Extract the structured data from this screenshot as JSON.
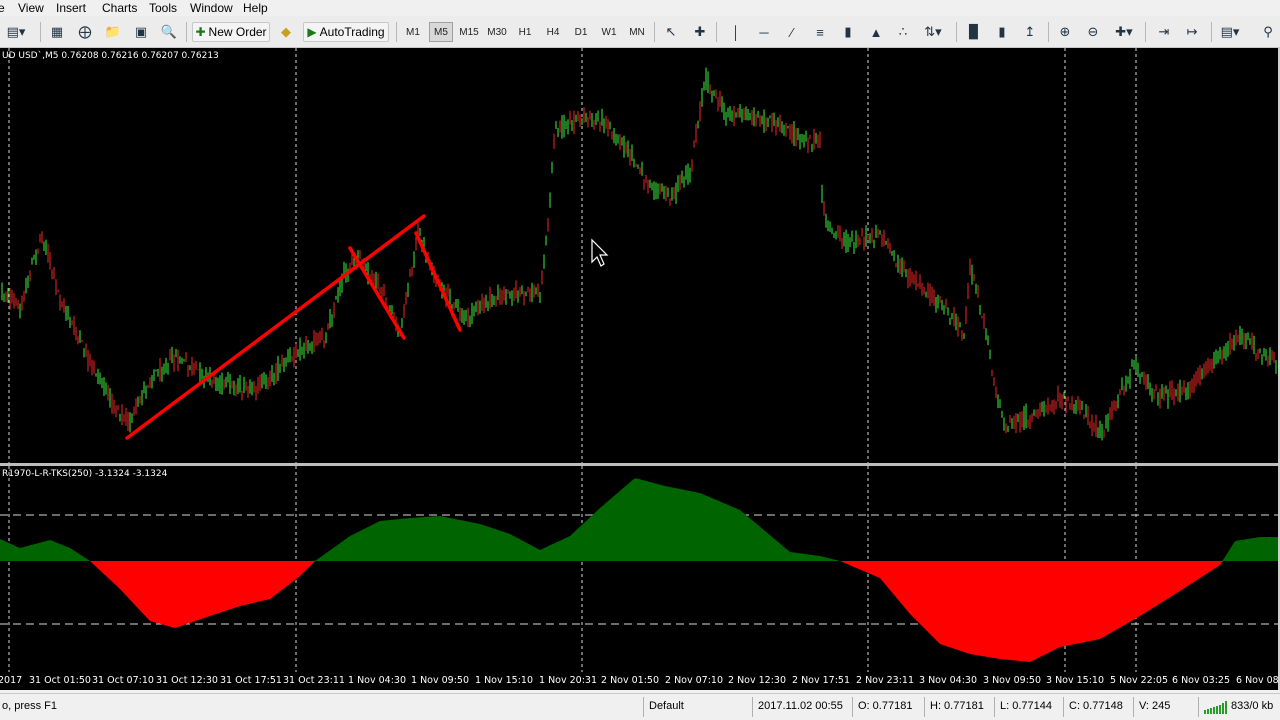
{
  "menu": {
    "items": [
      "e",
      "View",
      "Insert",
      "Charts",
      "Tools",
      "Window",
      "Help"
    ]
  },
  "toolbar": {
    "new_order_label": "New Order",
    "autotrading_label": "AutoTrading",
    "timeframes": [
      "M1",
      "M5",
      "M15",
      "M30",
      "H1",
      "H4",
      "D1",
      "W1",
      "MN"
    ],
    "active_timeframe": "M5"
  },
  "chart": {
    "symbol_header": "UD USD`,M5  0.76208 0.76216 0.76207 0.76213",
    "indicator_header": "R1970-L-R-TKS(250) -3.1324 -3.1324",
    "colors": {
      "background": "#000000",
      "bull_candle": "#33cc33",
      "bear_candle": "#cc2222",
      "trendline": "#ff0000",
      "indicator_positive": "#006400",
      "indicator_negative": "#ff0000"
    },
    "time_labels": [
      "2017",
      "31 Oct 01:50",
      "31 Oct 07:10",
      "31 Oct 12:30",
      "31 Oct 17:51",
      "31 Oct 23:11",
      "1 Nov 04:30",
      "1 Nov 09:50",
      "1 Nov 15:10",
      "1 Nov 20:31",
      "2 Nov 01:50",
      "2 Nov 07:10",
      "2 Nov 12:30",
      "2 Nov 17:51",
      "2 Nov 23:11",
      "3 Nov 04:30",
      "3 Nov 09:50",
      "3 Nov 15:10",
      "5 Nov 22:05",
      "6 Nov 03:25",
      "6 Nov 08:"
    ]
  },
  "status": {
    "help_text": "o, press F1",
    "profile": "Default",
    "datetime": "2017.11.02 00:55",
    "open": "O: 0.77181",
    "high": "H: 0.77181",
    "low": "L: 0.77144",
    "close": "C: 0.77148",
    "volume": "V: 245",
    "traffic": "833/0 kb"
  }
}
